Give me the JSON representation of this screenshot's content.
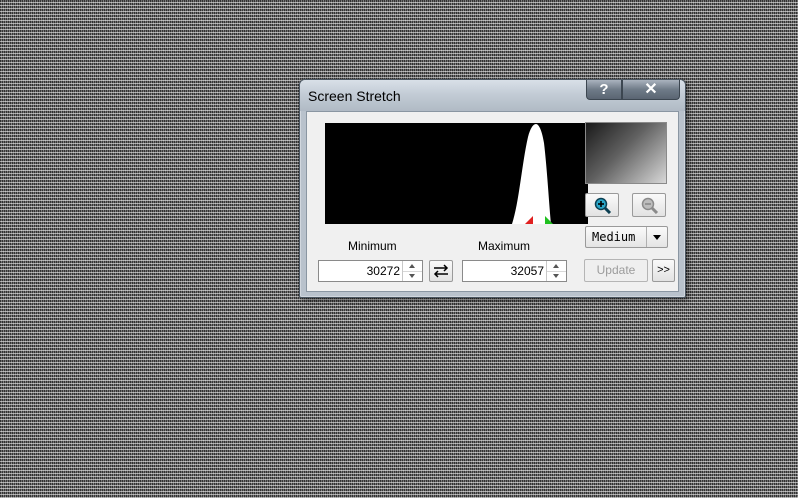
{
  "window": {
    "title": "Screen Stretch",
    "help_label": "?",
    "close_label": "✕"
  },
  "histogram": {
    "min_marker_color": "#e02020",
    "max_marker_color": "#20c020"
  },
  "labels": {
    "minimum": "Minimum",
    "maximum": "Maximum"
  },
  "fields": {
    "minimum_value": "30272",
    "maximum_value": "32057"
  },
  "zoom": {
    "zoom_in_icon": "zoom-in-icon",
    "zoom_out_icon": "zoom-out-icon"
  },
  "preset": {
    "selected": "Medium"
  },
  "buttons": {
    "update_label": "Update",
    "more_label": ">>",
    "swap_icon": "swap-arrows-icon"
  }
}
